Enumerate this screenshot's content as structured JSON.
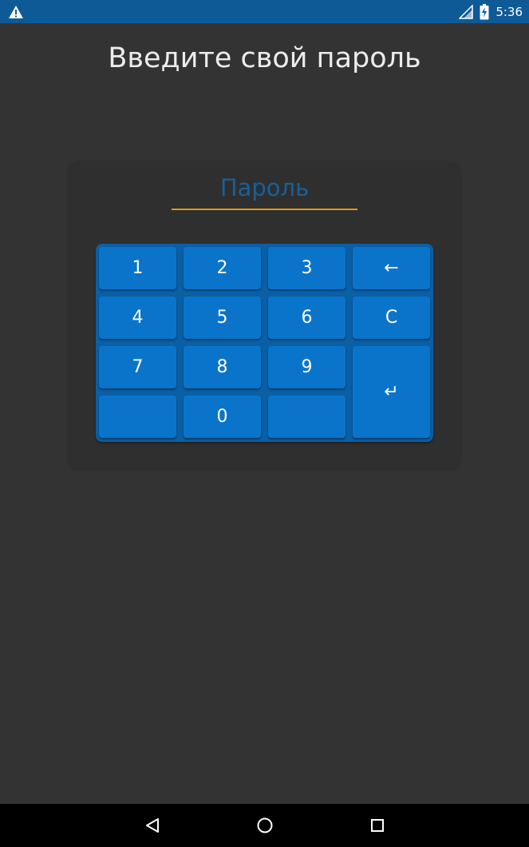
{
  "status_bar": {
    "time": "5:36",
    "icons": [
      "warning-icon",
      "signal-icon",
      "battery-charging-icon"
    ]
  },
  "screen": {
    "title": "Введите свой пароль"
  },
  "password": {
    "placeholder": "Пароль",
    "value": ""
  },
  "keypad": {
    "keys": {
      "k1": "1",
      "k2": "2",
      "k3": "3",
      "backspace": "←",
      "k4": "4",
      "k5": "5",
      "k6": "6",
      "clear": "C",
      "k7": "7",
      "k8": "8",
      "k9": "9",
      "enter": "↵",
      "blank_left": "",
      "k0": "0",
      "blank_right": ""
    }
  },
  "colors": {
    "status_bar": "#0e5a96",
    "background": "#333333",
    "keypad": "#0b5fa5",
    "key": "#0a74cb",
    "field_underline": "#e49a1a",
    "placeholder": "#1a5f98"
  },
  "nav_bar": {
    "icons": [
      "back-icon",
      "home-icon",
      "recent-apps-icon"
    ]
  }
}
